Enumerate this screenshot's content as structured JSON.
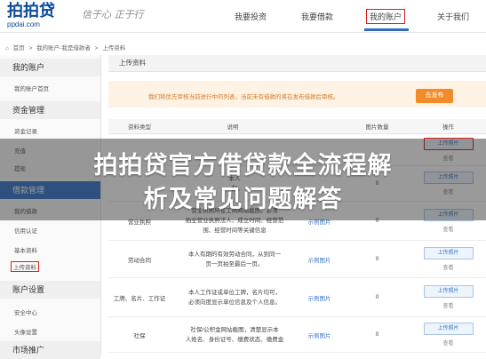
{
  "header": {
    "logo": "拍拍贷",
    "logo_url": "ppdai.com",
    "slogan": "信于心 正于行",
    "nav": [
      "我要投资",
      "我要借款",
      "我的账户",
      "关于我们"
    ]
  },
  "breadcrumb": [
    "首页",
    ">",
    "我的账户-我是借款者",
    ">",
    "上传资料"
  ],
  "sidebar": {
    "sections": [
      {
        "title": "我的账户",
        "items": [
          "我的账户首页"
        ]
      },
      {
        "title": "资金管理",
        "items": [
          "资金记录",
          "充值",
          "提现"
        ]
      },
      {
        "title": "借款管理",
        "items": [
          "我的借款",
          "信用认证",
          "基本资料",
          "上传资料"
        ]
      },
      {
        "title": "账户设置",
        "items": [
          "安全中心",
          "头像设置"
        ]
      },
      {
        "title": "市场推广",
        "items": []
      }
    ]
  },
  "main": {
    "panel_title": "上传资料",
    "notice": "我们将优先审核当前进行中的列表，当前未有借款的将在发布借款后审核。",
    "publish_button": "去发布",
    "columns": [
      "资料类型",
      "说明",
      "",
      "图片数量",
      "操作"
    ],
    "rows": [
      {
        "type": "",
        "desc": [
          "",
          ""
        ],
        "sample": "",
        "count": "",
        "upload": "上传照片",
        "view": "查看"
      },
      {
        "type": "",
        "desc": [
          "本人",
          "一起。"
        ],
        "sample": "",
        "count": "0",
        "upload": "上传照片",
        "view": "查看"
      },
      {
        "type": "营业执照",
        "desc": [
          "营业执照所在工商网站截图，必须",
          "拍全营业执照法人、成立时间、经营范",
          "围、经营时间等关键信息"
        ],
        "sample": "示例图片",
        "count": "0",
        "upload": "上传照片",
        "view": "查看"
      },
      {
        "type": "劳动合同",
        "desc": [
          "本人有期的有效劳动合同，从到同一",
          "页一页拍至最后一页。"
        ],
        "sample": "示例图片",
        "count": "0",
        "upload": "上传照片",
        "view": "查看"
      },
      {
        "type": "工牌、名片、工作证",
        "desc": [
          "本人工作证或单位工牌，名片均可，",
          "必须向度显示单位信息及个人信息。"
        ],
        "sample": "示例图片",
        "count": "0",
        "upload": "上传照片",
        "view": "查看"
      },
      {
        "type": "社保",
        "desc": [
          "社保/公积金网站截图，清楚显示本",
          "人姓名、身份证号、缴费状态、缴费金"
        ],
        "sample": "示例图片",
        "count": "0",
        "upload": "上传照片",
        "view": "查看"
      }
    ]
  },
  "overlay": {
    "line1": "拍拍贷官方借贷款全流程解",
    "line2": "析及常见问题解答"
  }
}
